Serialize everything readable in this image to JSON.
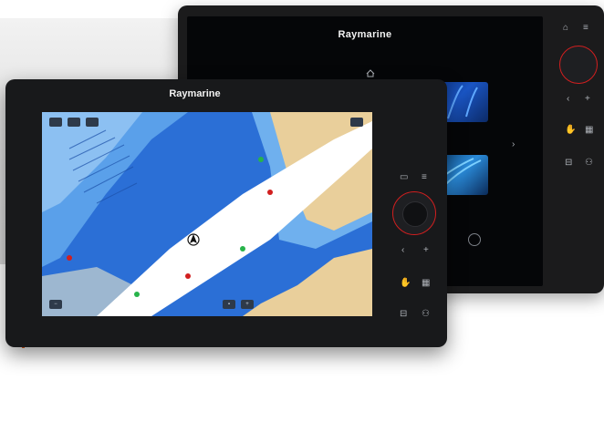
{
  "back_device": {
    "brand": "Raymarine",
    "status_left": "",
    "home_label": "",
    "status_right": "",
    "tiles": [
      {
        "label": ""
      },
      {
        "label": ""
      }
    ],
    "gauge_label": ""
  },
  "front_device": {
    "brand": "Raymarine",
    "bottom_label": "",
    "screen_buttons": [
      {
        "label": ""
      },
      {
        "label": ""
      },
      {
        "label": ""
      },
      {
        "label": ""
      }
    ]
  },
  "colors": {
    "accent_orange": "#e8641e",
    "knob_ring": "#d11f1f",
    "water_deep": "#2b6fd6",
    "water_shallow": "#a9d2f5",
    "land": "#e9cf9b",
    "channel": "#ffffff"
  },
  "icons": [
    "home-icon",
    "menu-icon",
    "chevron-left-icon",
    "plus-icon",
    "hand-icon",
    "grid-icon",
    "waypoint-icon",
    "user-icon",
    "gauge-icon",
    "settings-icon"
  ]
}
